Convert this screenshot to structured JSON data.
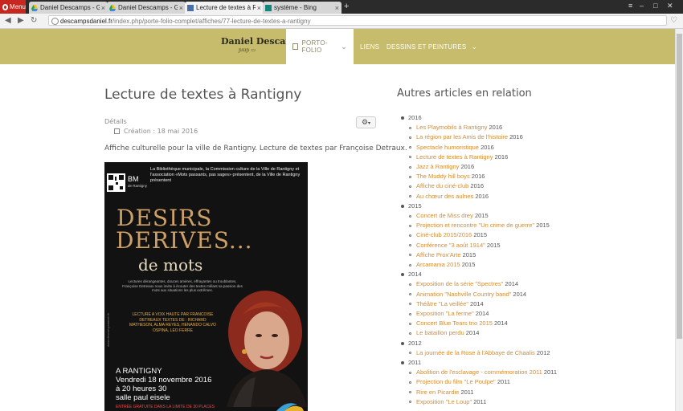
{
  "browser": {
    "menu_label": "Menu",
    "tabs": [
      {
        "title": "Daniel Descamps - Graph",
        "favicon": "drive-icon",
        "active": false
      },
      {
        "title": "Daniel Descamps - Graph",
        "favicon": "drive-icon",
        "active": false
      },
      {
        "title": "Lecture de textes à Rantig",
        "favicon": "site-icon",
        "active": true
      },
      {
        "title": "système - Bing",
        "favicon": "bing-icon",
        "active": false
      }
    ],
    "new_tab_label": "+",
    "url_domain": "descampsdaniel.fr",
    "url_path": "/index.php/porte-folio-complet/affiches/77-lecture-de-textes-a-rantigny"
  },
  "site": {
    "brand": "Daniel Descamps",
    "nav": [
      {
        "label": "PORTO-FOLIO",
        "active": true,
        "has_dropdown": true
      },
      {
        "label": "LIENS",
        "active": false,
        "has_dropdown": false
      },
      {
        "label": "DESSINS ET PEINTURES",
        "active": false,
        "has_dropdown": true
      }
    ],
    "header_color": "#c6bc6c"
  },
  "article": {
    "title": "Lecture de textes à Rantigny",
    "details_label": "Détails",
    "created": "Création : 18 mai 2016",
    "intro": "Affiche culturelle pour la ville de Rantigny. Lecture de textes par Françoise Detraux."
  },
  "poster": {
    "header_lines": "La Bibliothèque municipale, la Commission culture de la Ville de Rantigny et l'association «Mots passants, pas sages» présentent, de la Ville de Rantigny présentent",
    "bm_logo": "BM",
    "bm_sub": "de Rantigny",
    "title_1": "DESIRS",
    "title_2": "DERIVES...",
    "title_3": "de mots",
    "pitch": "Lectures dérangeantes, douces amères, effrayantes ou troublantes, Françoise Detreaux nous invite à écouter des textes mêlant sa passion des mots aux situations les plus extrêmes.",
    "lecture": "LECTURE A VOIX HAUTE PAR FRANCOISE DETREAUX TEXTES DE : RICHARD MATHESON, ALMA REYES, HENANDO CALVO OSPINA, LEO FERRE",
    "location": "A RANTIGNY",
    "date": "Vendredi 18 novembre 2016",
    "time": "à 20 heures 30",
    "venue": "salle paul eisele",
    "entry": "ENTRÉE GRATUITE DANS LA LIMITE DE 30 PLACES",
    "side_text": "www.descampsdaniel.fr"
  },
  "related": {
    "title": "Autres articles en relation",
    "groups": [
      {
        "year": "2016",
        "items": [
          {
            "title": "Les Playmobils à Rantigny",
            "year": "2016"
          },
          {
            "title": "La région par les Amis de l'histoire",
            "year": "2016"
          },
          {
            "title": "Spectacle humoristique",
            "year": "2016"
          },
          {
            "title": "Lecture de textes à Rantigny",
            "year": "2016"
          },
          {
            "title": "Jazz à Rantigny",
            "year": "2016"
          },
          {
            "title": "The Muddy hill boys",
            "year": "2016"
          },
          {
            "title": "Affiche du ciné-club",
            "year": "2016"
          },
          {
            "title": "Au chœur des aulnes",
            "year": "2016"
          }
        ]
      },
      {
        "year": "2015",
        "items": [
          {
            "title": "Concert de Miss drey",
            "year": "2015"
          },
          {
            "title": "Projection et rencontre \"Un crime de guerre\"",
            "year": "2015"
          },
          {
            "title": "Ciné-club 2015/2016",
            "year": "2015"
          },
          {
            "title": "Conférence \"3 août 1914\"",
            "year": "2015"
          },
          {
            "title": "Affiche Prox'Arte",
            "year": "2015"
          },
          {
            "title": "Arcamania 2015",
            "year": "2015"
          }
        ]
      },
      {
        "year": "2014",
        "items": [
          {
            "title": "Exposition de la série \"Spectres\"",
            "year": "2014"
          },
          {
            "title": "Animation \"Nashville Country band\"",
            "year": "2014"
          },
          {
            "title": "Théâtre \"La veillée\"",
            "year": "2014"
          },
          {
            "title": "Exposition \"La ferme\"",
            "year": "2014"
          },
          {
            "title": "Concert Blue Tears trio 2015",
            "year": "2014"
          },
          {
            "title": "Le bataillon perdu",
            "year": "2014"
          }
        ]
      },
      {
        "year": "2012",
        "items": [
          {
            "title": "La journée de la Rose à l'Abbaye de Chaalis",
            "year": "2012"
          }
        ]
      },
      {
        "year": "2011",
        "items": [
          {
            "title": "Abolition de l'esclavage - commémoration 2011",
            "year": "2011"
          },
          {
            "title": "Projection du film \"Le Poulpe\"",
            "year": "2011"
          },
          {
            "title": "Rire en Picardie",
            "year": "2011"
          },
          {
            "title": "Exposition \"Le Loup\"",
            "year": "2011"
          }
        ]
      }
    ]
  }
}
